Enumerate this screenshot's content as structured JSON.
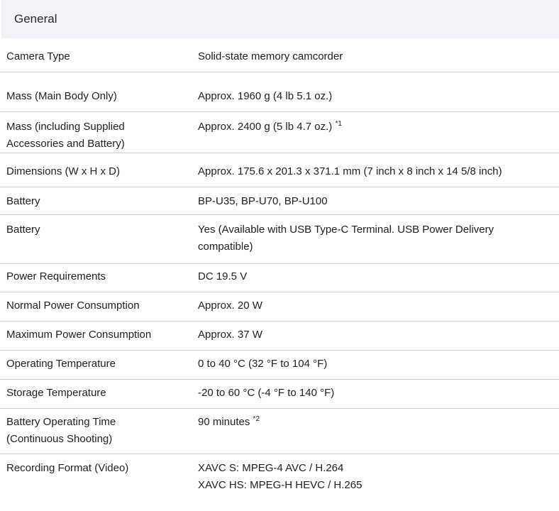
{
  "section": {
    "title": "General"
  },
  "rows": [
    {
      "label": "Camera Type",
      "value": "Solid-state memory camcorder"
    },
    {
      "label": "Mass (Main Body Only)",
      "value": "Approx. 1960 g (4 lb 5.1 oz.)"
    },
    {
      "label_line1": "Mass (including Supplied",
      "label_line2": "Accessories and Battery)",
      "value": "Approx. 2400 g (5 lb 4.7 oz.)",
      "note": "*1"
    },
    {
      "label": "Dimensions (W x H x D)",
      "value": "Approx. 175.6 x 201.3 x 371.1 mm (7 inch x 8 inch x 14 5/8 inch)"
    },
    {
      "label": "Battery",
      "value": "BP-U35, BP-U70, BP-U100"
    },
    {
      "label": "Battery",
      "value_line1": "Yes (Available with USB Type-C Terminal. USB Power Delivery",
      "value_line2": "compatible)"
    },
    {
      "label": "Power Requirements",
      "value": "DC 19.5 V"
    },
    {
      "label": "Normal Power Consumption",
      "value": "Approx. 20 W"
    },
    {
      "label": "Maximum Power Consumption",
      "value": "Approx. 37 W"
    },
    {
      "label": "Operating Temperature",
      "value": "0 to 40 °C (32 °F to 104 °F)"
    },
    {
      "label": "Storage Temperature",
      "value": "-20 to 60 °C (-4 °F to 140 °F)"
    },
    {
      "label_line1": "Battery Operating Time",
      "label_line2": "(Continuous Shooting)",
      "value": "90 minutes",
      "note": "*2"
    },
    {
      "label": "Recording Format (Video)",
      "value_line1": "XAVC S: MPEG-4 AVC / H.264",
      "value_line2": "XAVC HS: MPEG-H HEVC / H.265"
    }
  ]
}
